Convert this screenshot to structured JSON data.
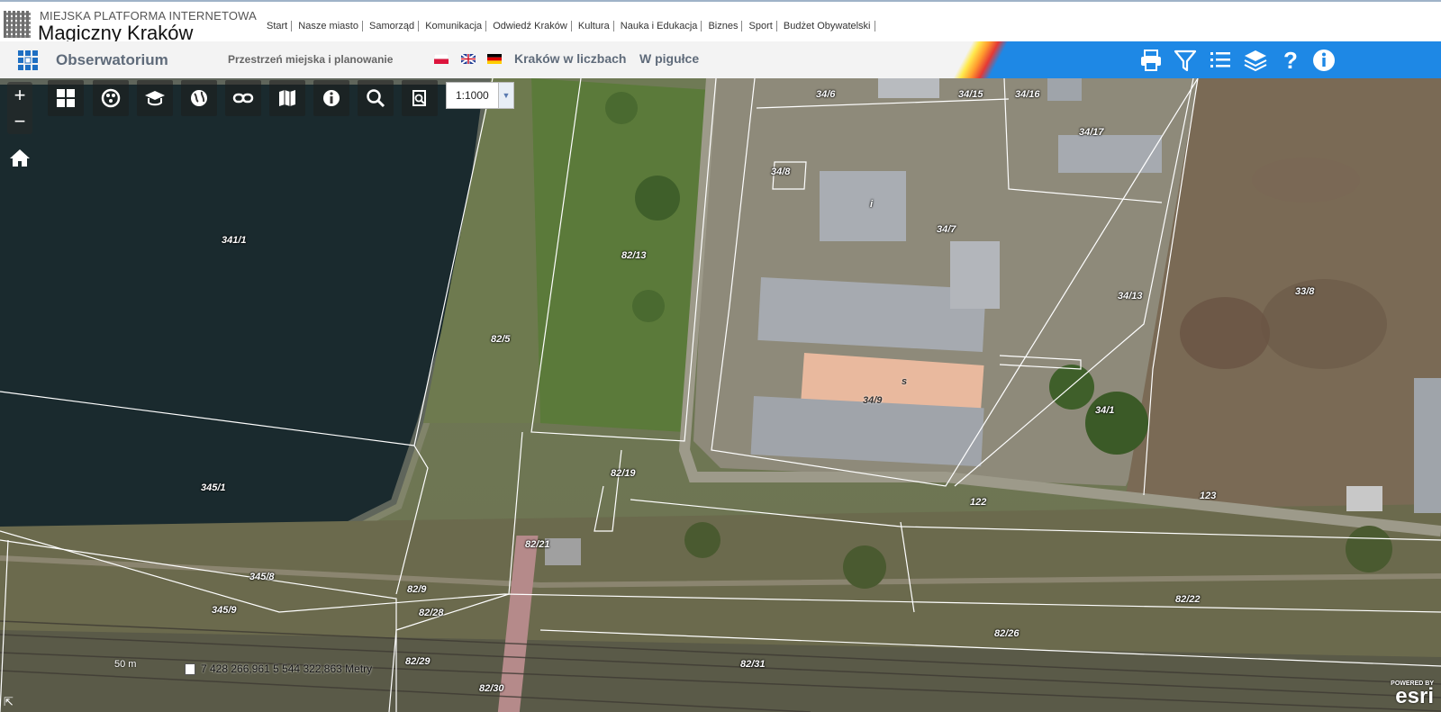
{
  "header": {
    "brand_sub": "MIEJSKA PLATFORMA INTERNETOWA",
    "brand_main": "Magiczny Kraków",
    "nav": [
      "Start",
      "Nasze miasto",
      "Samorząd",
      "Komunikacja",
      "Odwiedź Kraków",
      "Kultura",
      "Nauka i Edukacja",
      "Biznes",
      "Sport",
      "Budżet Obywatelski"
    ]
  },
  "appbar": {
    "title": "Obserwatorium",
    "section": "Przestrzeń miejska i planowanie",
    "link_numbers": "Kraków w liczbach",
    "link_summary": "W pigułce",
    "accent": "#1e88e5",
    "tools": [
      "print-icon",
      "filter-icon",
      "list-icon",
      "layers-icon",
      "help-icon",
      "info-icon"
    ]
  },
  "map_tools": {
    "icons": [
      "grid-icon",
      "palette-icon",
      "education-icon",
      "globe-icon",
      "link-icon",
      "map-icon",
      "info-icon",
      "search-icon",
      "zoom-document-icon"
    ],
    "scale": "1:1000",
    "zoom_in": "+",
    "zoom_out": "−"
  },
  "parcels": [
    "341/1",
    "345/1",
    "82/5",
    "82/13",
    "82/19",
    "82/21",
    "82/9",
    "82/28",
    "82/29",
    "82/30",
    "82/31",
    "82/26",
    "82/22",
    "345/8",
    "345/9",
    "34/6",
    "34/15",
    "34/16",
    "34/17",
    "34/8",
    "34/7",
    "34/13",
    "34/9",
    "34/1",
    "33/8",
    "122",
    "123",
    "i",
    "s"
  ],
  "status": {
    "coords": "7 428 266,961  5 544 322,863 Metry",
    "scale_bar": "50 m",
    "esri_powered": "POWERED BY",
    "esri": "esri"
  }
}
